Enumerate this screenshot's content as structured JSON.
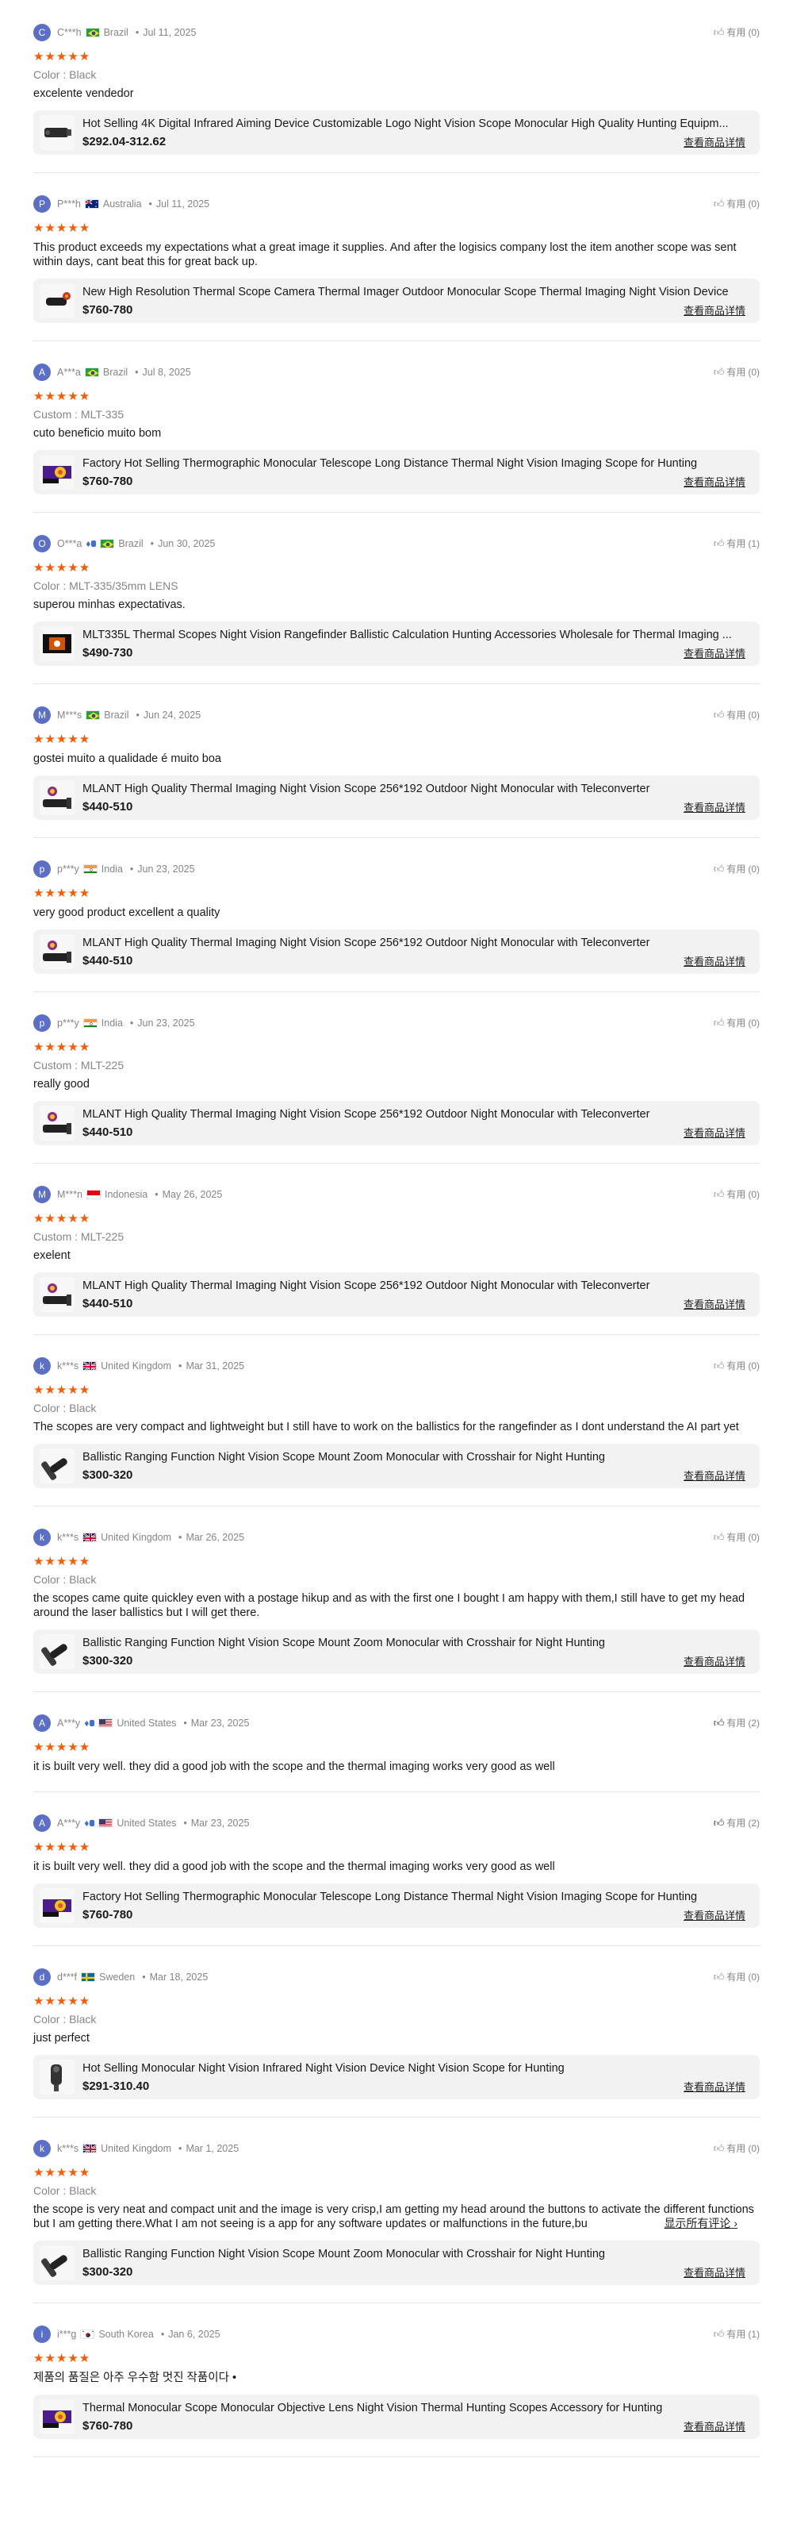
{
  "helpful_label": "有用",
  "view_product_label": "查看商品详情",
  "more_label": "显示所有评论",
  "colors": {
    "star": "#fd5a00",
    "avatar": "#5b6fc7",
    "vip": "#3d6fe2"
  },
  "reviews": [
    {
      "initial": "C",
      "user": "C***h",
      "flag": "br",
      "vip": false,
      "country": "Brazil",
      "date": "Jul 11, 2025",
      "helpful": "(0)",
      "thumb_filled": false,
      "stars": "★★★★★",
      "meta": "Color : Black",
      "text": "excelente vendedor",
      "product_title": "Hot Selling 4K Digital Infrared Aiming Device Customizable Logo Night Vision Scope Monocular High Quality Hunting Equipm...",
      "product_price": "$292.04-312.62",
      "thumb_icon": "night-vision-scope",
      "truncated": false
    },
    {
      "initial": "P",
      "user": "P***h",
      "flag": "au",
      "vip": false,
      "country": "Australia",
      "date": "Jul 11, 2025",
      "helpful": "(0)",
      "thumb_filled": false,
      "stars": "★★★★★",
      "meta": "",
      "text": "This product exceeds my expectations what a great image it supplies. And after the logisics company lost the item another scope was sent within days, cant beat this for great back up.",
      "product_title": "New High Resolution Thermal Scope Camera Thermal Imager Outdoor Monocular Scope Thermal Imaging Night Vision Device",
      "product_price": "$760-780",
      "thumb_icon": "thermal-scope",
      "truncated": false
    },
    {
      "initial": "A",
      "user": "A***a",
      "flag": "br",
      "vip": false,
      "country": "Brazil",
      "date": "Jul 8, 2025",
      "helpful": "(0)",
      "thumb_filled": false,
      "stars": "★★★★★",
      "meta": "Custom : MLT-335",
      "text": "cuto beneficio muito bom",
      "product_title": "Factory Hot Selling Thermographic Monocular Telescope Long Distance Thermal Night Vision Imaging Scope for Hunting",
      "product_price": "$760-780",
      "thumb_icon": "thermal-monocular",
      "truncated": false
    },
    {
      "initial": "O",
      "user": "O***a",
      "flag": "br",
      "vip": true,
      "country": "Brazil",
      "date": "Jun 30, 2025",
      "helpful": "(1)",
      "thumb_filled": false,
      "stars": "★★★★★",
      "meta": "Color : MLT-335/35mm LENS",
      "text": "superou minhas expectativas.",
      "product_title": "MLT335L Thermal Scopes Night Vision Rangefinder Ballistic Calculation Hunting Accessories Wholesale for Thermal Imaging ...",
      "product_price": "$490-730",
      "thumb_icon": "rangefinder-scope",
      "truncated": false
    },
    {
      "initial": "M",
      "user": "M***s",
      "flag": "br",
      "vip": false,
      "country": "Brazil",
      "date": "Jun 24, 2025",
      "helpful": "(0)",
      "thumb_filled": false,
      "stars": "★★★★★",
      "meta": "",
      "text": "gostei muito a qualidade é muito boa",
      "product_title": "MLANT High Quality Thermal Imaging Night Vision Scope 256*192 Outdoor Night Monocular with Teleconverter",
      "product_price": "$440-510",
      "thumb_icon": "mlant-scope",
      "truncated": false
    },
    {
      "initial": "p",
      "user": "p***y",
      "flag": "in",
      "vip": false,
      "country": "India",
      "date": "Jun 23, 2025",
      "helpful": "(0)",
      "thumb_filled": false,
      "stars": "★★★★★",
      "meta": "",
      "text": "very good product excellent a quality",
      "product_title": "MLANT High Quality Thermal Imaging Night Vision Scope 256*192 Outdoor Night Monocular with Teleconverter",
      "product_price": "$440-510",
      "thumb_icon": "mlant-scope",
      "truncated": false
    },
    {
      "initial": "p",
      "user": "p***y",
      "flag": "in",
      "vip": false,
      "country": "India",
      "date": "Jun 23, 2025",
      "helpful": "(0)",
      "thumb_filled": false,
      "stars": "★★★★★",
      "meta": "Custom : MLT-225",
      "text": "really good",
      "product_title": "MLANT High Quality Thermal Imaging Night Vision Scope 256*192 Outdoor Night Monocular with Teleconverter",
      "product_price": "$440-510",
      "thumb_icon": "mlant-scope",
      "truncated": false
    },
    {
      "initial": "M",
      "user": "M***n",
      "flag": "id",
      "vip": false,
      "country": "Indonesia",
      "date": "May 26, 2025",
      "helpful": "(0)",
      "thumb_filled": false,
      "stars": "★★★★★",
      "meta": "Custom : MLT-225",
      "text": "exelent",
      "product_title": "MLANT High Quality Thermal Imaging Night Vision Scope 256*192 Outdoor Night Monocular with Teleconverter",
      "product_price": "$440-510",
      "thumb_icon": "mlant-scope",
      "truncated": false
    },
    {
      "initial": "k",
      "user": "k***s",
      "flag": "gb",
      "vip": false,
      "country": "United Kingdom",
      "date": "Mar 31, 2025",
      "helpful": "(0)",
      "thumb_filled": false,
      "stars": "★★★★★",
      "meta": "Color : Black",
      "text": "The scopes are very compact and lightweight but I still have to work on the ballistics for the rangefinder as I dont understand the AI part yet",
      "product_title": "Ballistic Ranging Function Night Vision Scope Mount Zoom Monocular with Crosshair for Night Hunting",
      "product_price": "$300-320",
      "thumb_icon": "ballistic-scope",
      "truncated": false
    },
    {
      "initial": "k",
      "user": "k***s",
      "flag": "gb",
      "vip": false,
      "country": "United Kingdom",
      "date": "Mar 26, 2025",
      "helpful": "(0)",
      "thumb_filled": false,
      "stars": "★★★★★",
      "meta": "Color : Black",
      "text": "the scopes came quite quickley even with a postage hikup and as with the first one I bought I am happy with them,I still have to get my head around the laser ballistics but I will get there.",
      "product_title": "Ballistic Ranging Function Night Vision Scope Mount Zoom Monocular with Crosshair for Night Hunting",
      "product_price": "$300-320",
      "thumb_icon": "ballistic-scope",
      "truncated": false
    },
    {
      "initial": "A",
      "user": "A***y",
      "flag": "us",
      "vip": true,
      "country": "United States",
      "date": "Mar 23, 2025",
      "helpful": "(2)",
      "thumb_filled": true,
      "stars": "★★★★★",
      "meta": "",
      "text": "it is built very well. they did a good job with the scope and the thermal imaging works very good as well",
      "product_title": "",
      "product_price": "",
      "thumb_icon": "",
      "truncated": false
    },
    {
      "initial": "A",
      "user": "A***y",
      "flag": "us",
      "vip": true,
      "country": "United States",
      "date": "Mar 23, 2025",
      "helpful": "(2)",
      "thumb_filled": true,
      "stars": "★★★★★",
      "meta": "",
      "text": "it is built very well. they did a good job with the scope and the thermal imaging works very good as well",
      "product_title": "Factory Hot Selling Thermographic Monocular Telescope Long Distance Thermal Night Vision Imaging Scope for Hunting",
      "product_price": "$760-780",
      "thumb_icon": "thermal-monocular",
      "truncated": false
    },
    {
      "initial": "d",
      "user": "d***f",
      "flag": "se",
      "vip": false,
      "country": "Sweden",
      "date": "Mar 18, 2025",
      "helpful": "(0)",
      "thumb_filled": false,
      "stars": "★★★★★",
      "meta": "Color : Black",
      "text": "just perfect",
      "product_title": "Hot Selling Monocular Night Vision Infrared Night Vision Device Night Vision Scope for Hunting",
      "product_price": "$291-310.40",
      "thumb_icon": "night-vision-device",
      "truncated": false
    },
    {
      "initial": "k",
      "user": "k***s",
      "flag": "gb",
      "vip": false,
      "country": "United Kingdom",
      "date": "Mar 1, 2025",
      "helpful": "(0)",
      "thumb_filled": false,
      "stars": "★★★★★",
      "meta": "Color : Black",
      "text": "the scope is very neat and compact unit and the image is very crisp,I am getting my head around the buttons to activate the different functions but I am getting there.What I am not seeing is a app for any software updates or malfunctions in the future,bu",
      "product_title": "Ballistic Ranging Function Night Vision Scope Mount Zoom Monocular with Crosshair for Night Hunting",
      "product_price": "$300-320",
      "thumb_icon": "ballistic-scope",
      "truncated": true
    },
    {
      "initial": "i",
      "user": "i***g",
      "flag": "kr",
      "vip": false,
      "country": "South Korea",
      "date": "Jan 6, 2025",
      "helpful": "(1)",
      "thumb_filled": false,
      "stars": "★★★★★",
      "meta": "",
      "text": "제품의 품질은 아주 우수함 멋진 작품이다 •",
      "product_title": "Thermal Monocular Scope Monocular Objective Lens Night Vision Thermal Hunting Scopes Accessory for Hunting",
      "product_price": "$760-780",
      "thumb_icon": "thermal-monocular",
      "truncated": false
    }
  ]
}
